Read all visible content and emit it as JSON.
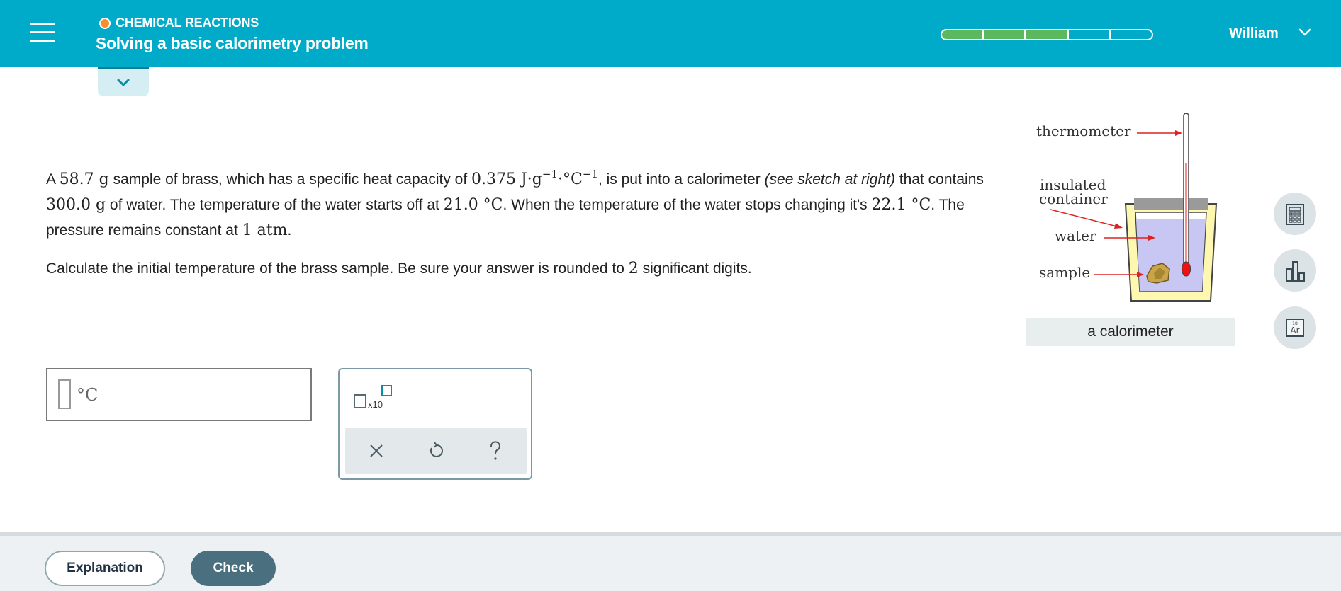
{
  "header": {
    "topic": "CHEMICAL REACTIONS",
    "title": "Solving a basic calorimetry problem",
    "progress": {
      "filled": 3,
      "total": 5
    },
    "user": "William",
    "accent": "#00abc9",
    "dot_color": "#f68e2d",
    "progress_color": "#5cb85c"
  },
  "problem": {
    "p1": "A ",
    "mass_brass": "58.7 g",
    "p2": " sample of brass, which has a specific heat capacity of ",
    "cp_value": "0.375  J·g",
    "cp_exp1": "−1",
    "cp_mid": "·°C",
    "cp_exp2": "−1",
    "p3": ", is put into a calorimeter ",
    "see_sketch": "(see sketch at right)",
    "p4": " that contains ",
    "mass_water": "300.0 g",
    "p5": " of water. The temperature of the water starts off at ",
    "t_start": "21.0 °C",
    "p6": ". When the temperature of the water stops changing it's ",
    "t_final": "22.1 °C",
    "p7": ". The pressure remains constant at ",
    "pressure": "1 atm",
    "p8": "."
  },
  "question": {
    "q1": "Calculate the initial temperature of the brass sample. Be sure your answer is rounded to ",
    "digits": "2",
    "q2": " significant digits."
  },
  "figure": {
    "labels": {
      "thermometer": "thermometer",
      "insulated1": "insulated",
      "insulated2": "container",
      "water": "water",
      "sample": "sample"
    },
    "caption": "a calorimeter"
  },
  "answer": {
    "unit": "°C",
    "value": ""
  },
  "panel": {
    "sci_label": "x10"
  },
  "tools": {
    "calculator": "calculator-icon",
    "chart": "data-chart-icon",
    "periodic_number": "18",
    "periodic_symbol": "Ar"
  },
  "footer": {
    "explanation": "Explanation",
    "check": "Check"
  }
}
